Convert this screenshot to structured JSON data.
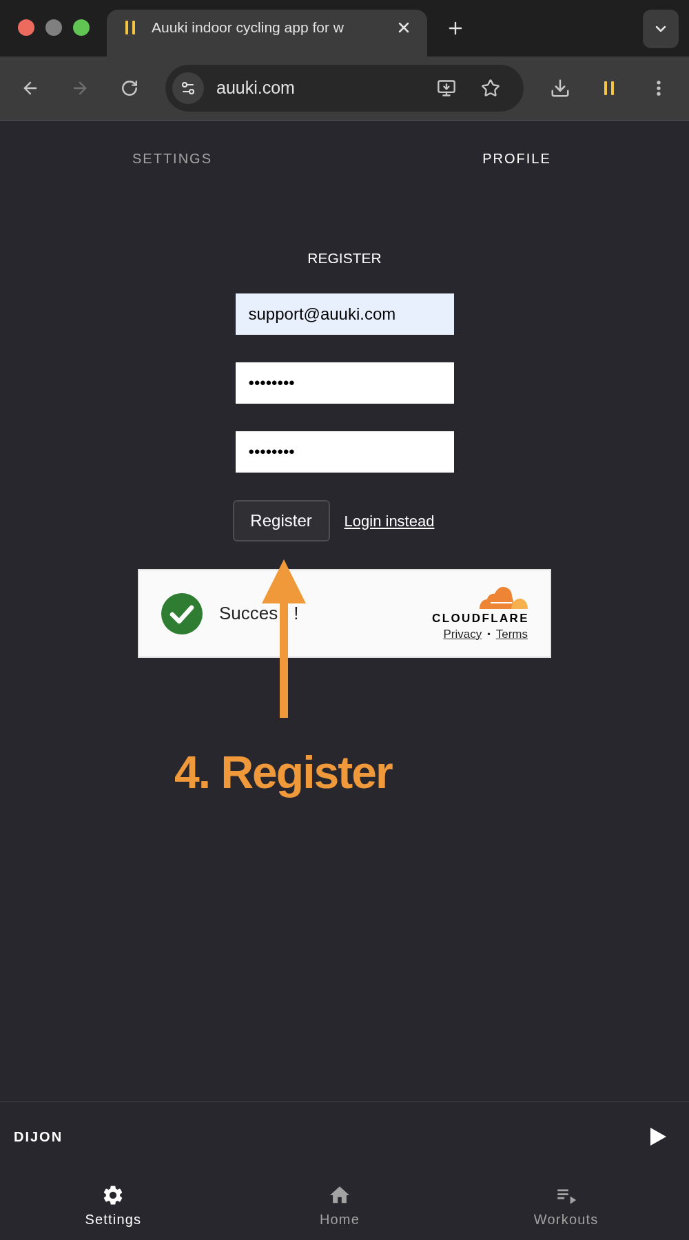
{
  "browser": {
    "tab_title": "Auuki indoor cycling app for w",
    "address": "auuki.com",
    "forward_disabled": true
  },
  "tabs": [
    {
      "label": "SETTINGS",
      "selected": false
    },
    {
      "label": "PROFILE",
      "selected": true
    }
  ],
  "form": {
    "title": "REGISTER",
    "fields": [
      {
        "value": "support@auuki.com",
        "autofilled": true
      },
      {
        "value": "••••••••",
        "autofilled": false
      },
      {
        "value": "••••••••",
        "autofilled": false
      }
    ],
    "submit": "Register",
    "alt_link": "Login instead"
  },
  "captcha": {
    "status": [
      "Succes",
      "!"
    ],
    "brand": "CLOUDFLARE",
    "links": [
      "Privacy",
      "Terms"
    ],
    "separator": "•"
  },
  "annotation": {
    "label": "4. Register"
  },
  "player": {
    "title": "DIJON"
  },
  "nav": [
    {
      "label": "Settings",
      "selected": true
    },
    {
      "label": "Home",
      "selected": false
    },
    {
      "label": "Workouts",
      "selected": false
    }
  ]
}
